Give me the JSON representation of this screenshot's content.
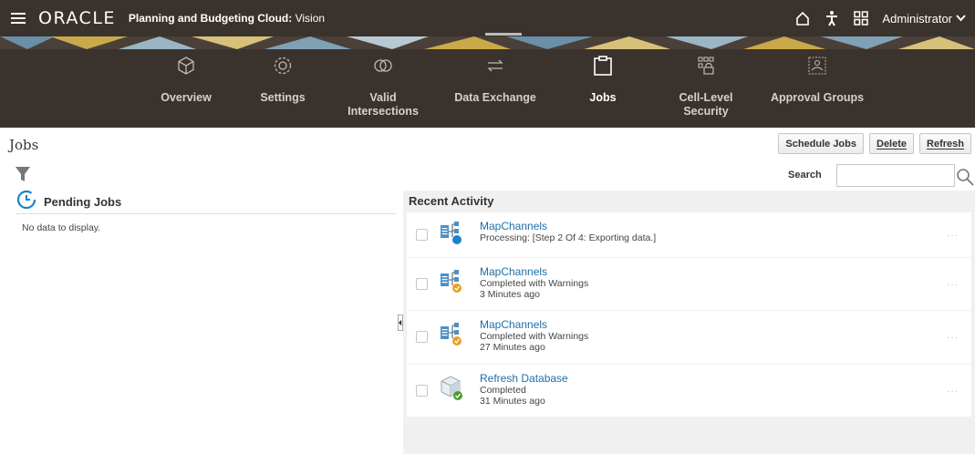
{
  "app": {
    "brand": "ORACLE",
    "product_bold": "Planning and Budgeting Cloud:",
    "product_env": "Vision",
    "user": "Administrator"
  },
  "icons": {
    "menu": "hamburger-menu-icon",
    "home": "home-icon",
    "accessibility": "accessibility-icon",
    "navigator": "navigator-grid-icon",
    "filter": "filter-icon",
    "search": "search-icon",
    "pending": "clock-icon"
  },
  "nav": {
    "items": [
      {
        "label": "Overview",
        "icon": "cube-icon"
      },
      {
        "label": "Settings",
        "icon": "gear-icon"
      },
      {
        "label": "Valid Intersections",
        "icon": "intersections-icon"
      },
      {
        "label": "Data Exchange",
        "icon": "exchange-arrows-icon"
      },
      {
        "label": "Jobs",
        "icon": "clipboard-icon",
        "active": true
      },
      {
        "label": "Cell-Level Security",
        "icon": "cell-security-icon"
      },
      {
        "label": "Approval Groups",
        "icon": "approval-groups-icon"
      }
    ]
  },
  "page": {
    "title": "Jobs",
    "actions": {
      "schedule": "Schedule Jobs",
      "delete": "Delete",
      "refresh": "Refresh"
    },
    "search_label": "Search",
    "search_value": ""
  },
  "pending": {
    "title": "Pending Jobs",
    "empty": "No data to display."
  },
  "recent": {
    "title": "Recent Activity",
    "jobs": [
      {
        "name": "MapChannels",
        "status": "Processing: [Step 2 Of 4: Exporting data.]",
        "time": "",
        "kind": "processing"
      },
      {
        "name": "MapChannels",
        "status": "Completed with Warnings",
        "time": "3 Minutes ago",
        "kind": "warning"
      },
      {
        "name": "MapChannels",
        "status": "Completed with Warnings",
        "time": "27 Minutes ago",
        "kind": "warning"
      },
      {
        "name": "Refresh Database",
        "status": "Completed",
        "time": "31 Minutes ago",
        "kind": "completed"
      }
    ],
    "more_label": "···"
  },
  "colors": {
    "header_bg": "#3a322d",
    "link": "#1f6fa8",
    "processing": "#1a84c7",
    "warning": "#e6a020",
    "completed": "#4b9e2f"
  }
}
